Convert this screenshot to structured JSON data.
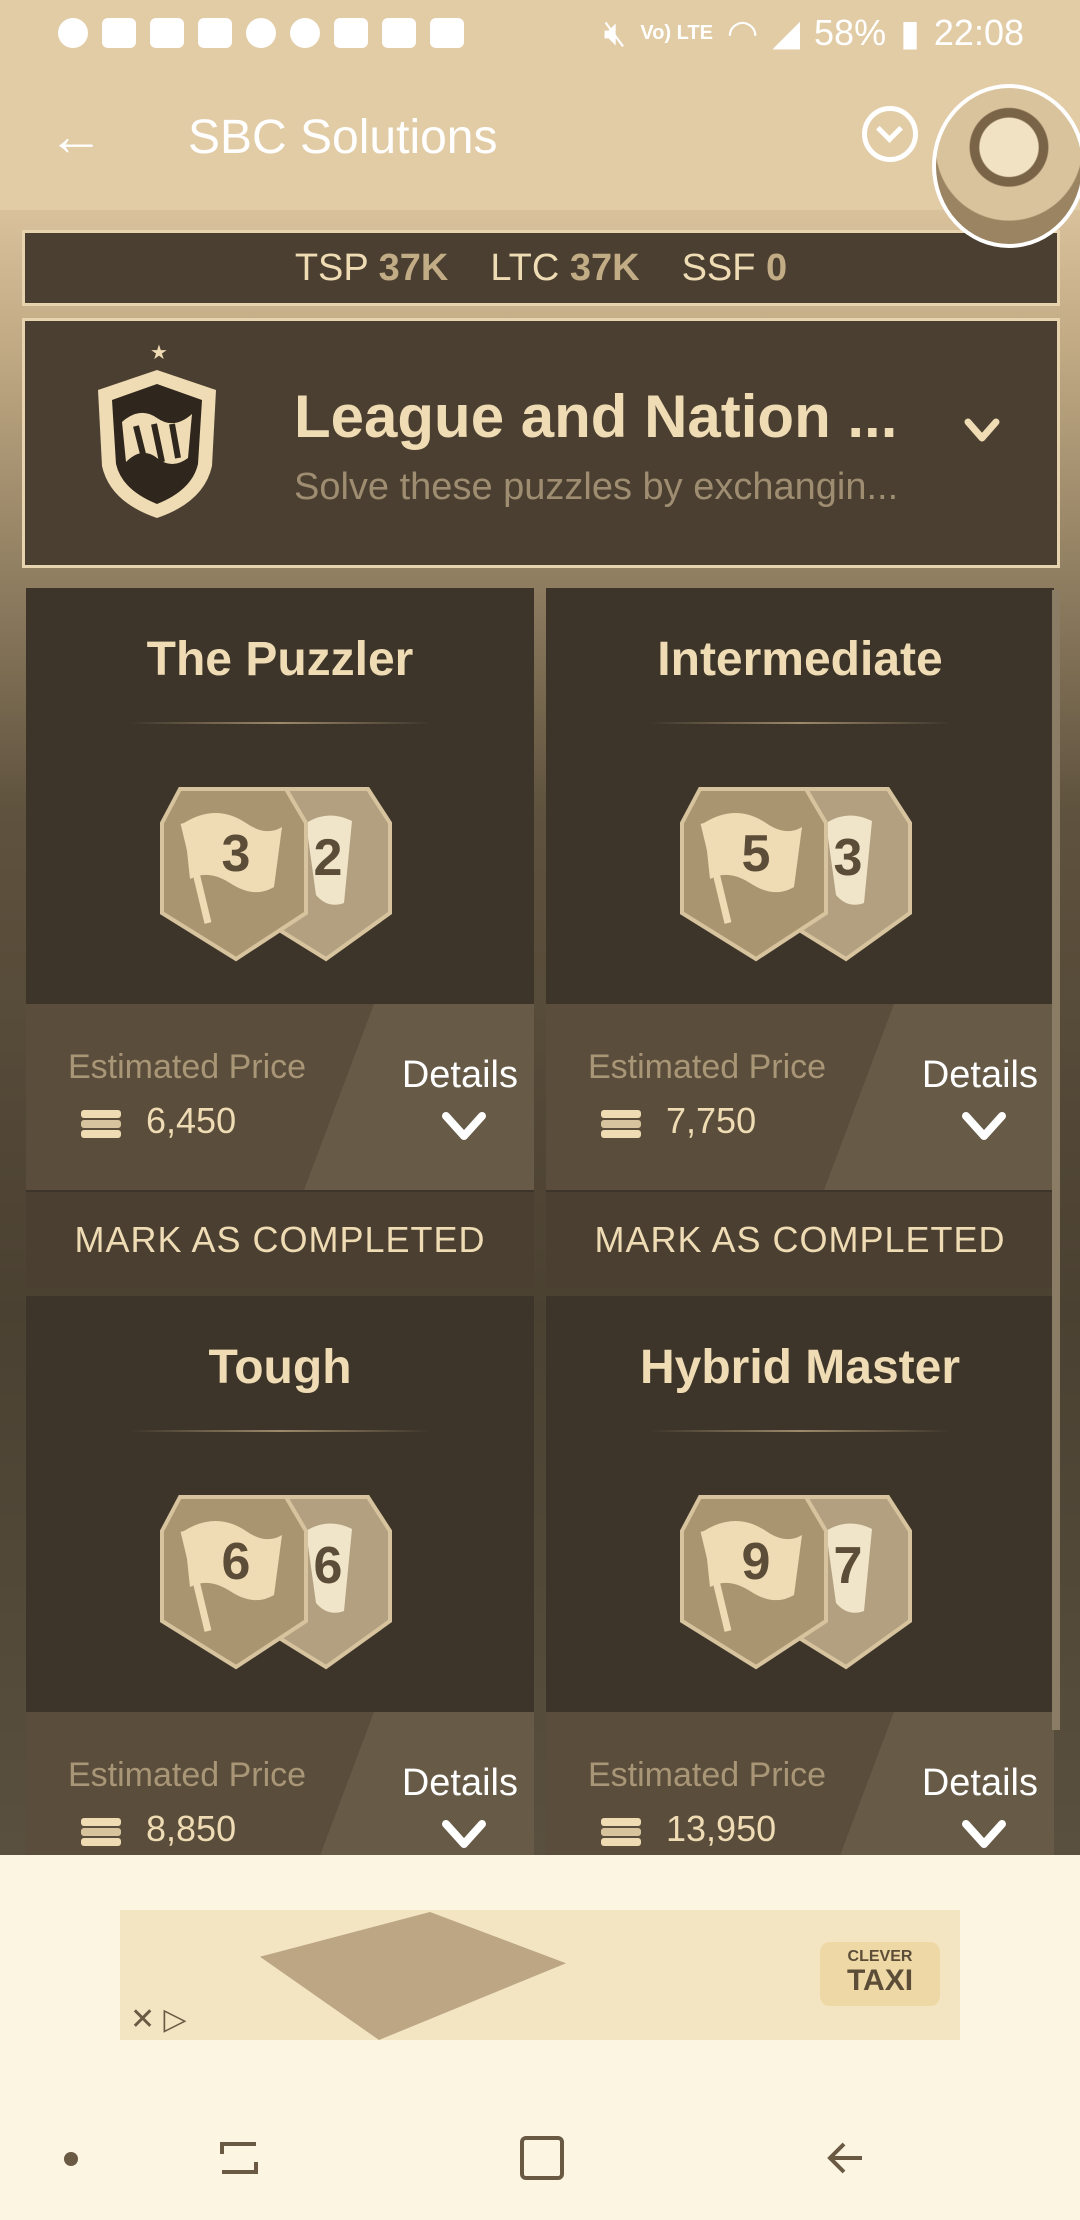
{
  "status_bar": {
    "battery": "58%",
    "time": "22:08",
    "volte_label": "Vo) LTE"
  },
  "app_bar": {
    "back_icon": "arrow-left-icon",
    "title": "SBC Solutions"
  },
  "stats": [
    {
      "label": "TSP",
      "value": "37K"
    },
    {
      "label": "LTC",
      "value": "37K"
    },
    {
      "label": "SSF",
      "value": "0"
    }
  ],
  "group": {
    "title": "League and Nation ...",
    "description": "Solve these puzzles by exchangin..."
  },
  "cards": [
    {
      "title": "The Puzzler",
      "badge_league": "3",
      "badge_nation": "2",
      "price_label": "Estimated Price",
      "price": "6,450",
      "details": "Details",
      "mark": "MARK AS COMPLETED"
    },
    {
      "title": "Intermediate",
      "badge_league": "5",
      "badge_nation": "3",
      "price_label": "Estimated Price",
      "price": "7,750",
      "details": "Details",
      "mark": "MARK AS COMPLETED"
    },
    {
      "title": "Tough",
      "badge_league": "6",
      "badge_nation": "6",
      "price_label": "Estimated Price",
      "price": "8,850",
      "details": "Details"
    },
    {
      "title": "Hybrid Master",
      "badge_league": "9",
      "badge_nation": "7",
      "price_label": "Estimated Price",
      "price": "13,950",
      "details": "Details"
    }
  ],
  "ad": {
    "brand_line1": "CLEVER",
    "brand_line2": "TAXI",
    "close_label": "✕ ▷"
  },
  "colors": {
    "background": "#e2cca6",
    "card": "#3e352a",
    "accent_text": "#efdcb4",
    "price_panel": "#5a4d3b"
  }
}
